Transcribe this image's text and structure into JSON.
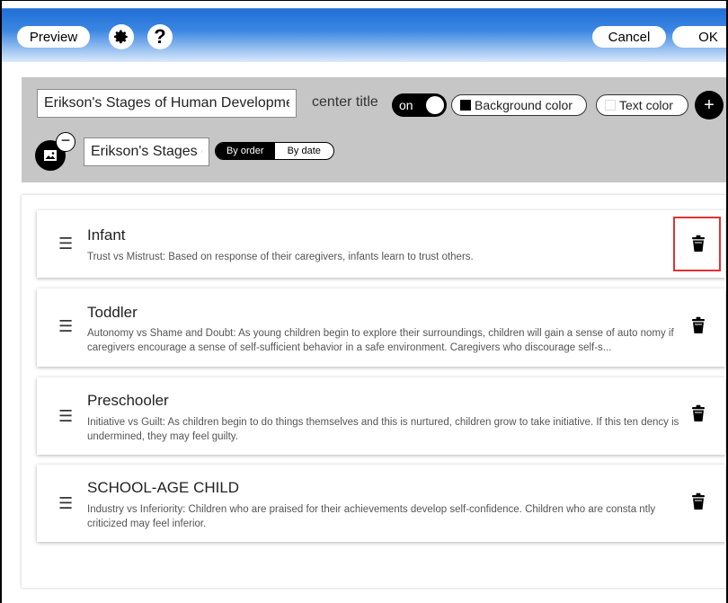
{
  "toolbar": {
    "preview_label": "Preview",
    "gear_icon": "gear-icon",
    "help_icon": "?",
    "cancel_label": "Cancel",
    "ok_label": "OK"
  },
  "settings": {
    "title_value": "Erikson's Stages of Human Development",
    "center_title_label": "center title",
    "toggle_label": "on",
    "background_color_label": "Background color",
    "background_color_swatch": "#000000",
    "text_color_label": "Text color",
    "text_color_swatch": "#ffffff",
    "add_icon": "+",
    "subtitle_value": "Erikson's Stages of Human Development",
    "sort": {
      "by_order": "By order",
      "by_date": "By date",
      "selected": "By order"
    }
  },
  "items": [
    {
      "title": "Infant",
      "description": "Trust vs Mistrust: Based on response of their caregivers, infants learn to trust others."
    },
    {
      "title": "Toddler",
      "description": "Autonomy vs Shame and Doubt: As young children begin to explore their surroundings, children will gain a sense of auto nomy if caregivers encourage a sense of self-sufficient behavior in a safe environment. Caregivers who discourage self-s..."
    },
    {
      "title": "Preschooler",
      "description": "Initiative vs Guilt: As children begin to do things themselves and this is nurtured, children grow to take initiative. If this ten dency is undermined, they may feel guilty."
    },
    {
      "title": "SCHOOL-AGE CHILD",
      "description": "Industry vs Inferiority: Children who are praised for their achievements develop self-confidence. Children who are consta ntly criticized may feel inferior."
    }
  ],
  "colors": {
    "toolbar_blue": "#3a86e2",
    "panel_gray": "#c6c6c6",
    "highlight_red": "#e03232"
  }
}
